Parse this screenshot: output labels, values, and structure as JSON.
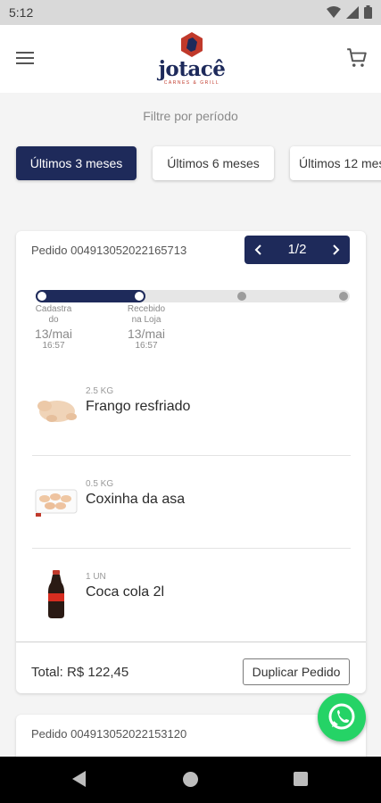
{
  "status_bar": {
    "time": "5:12"
  },
  "header": {
    "logo_text": "jotacê",
    "logo_sub": "CARNES & GRILL"
  },
  "filter": {
    "label": "Filtre por período",
    "options": [
      "Últimos 3 meses",
      "Últimos 6 meses",
      "Últimos 12 meses"
    ],
    "selected_index": 0
  },
  "order": {
    "id_label": "Pedido 004913052022165713",
    "pager": {
      "text": "1/2"
    },
    "steps": [
      {
        "name": "Cadastrado",
        "date": "13/mai",
        "time": "16:57"
      },
      {
        "name": "Recebido na Loja",
        "date": "13/mai",
        "time": "16:57"
      }
    ],
    "items": [
      {
        "qty": "2.5 KG",
        "name": "Frango resfriado",
        "icon": "chicken-image"
      },
      {
        "qty": "0.5 KG",
        "name": "Coxinha da asa",
        "icon": "wings-tray-image"
      },
      {
        "qty": "1 UN",
        "name": "Coca cola 2l",
        "icon": "soda-bottle-image"
      }
    ],
    "total": "Total: R$ 122,45",
    "duplicate_label": "Duplicar Pedido"
  },
  "next_order": {
    "id_label": "Pedido 004913052022153120"
  },
  "colors": {
    "primary": "#1e2a5a",
    "whatsapp": "#25d366",
    "accent_red": "#c0392b"
  }
}
